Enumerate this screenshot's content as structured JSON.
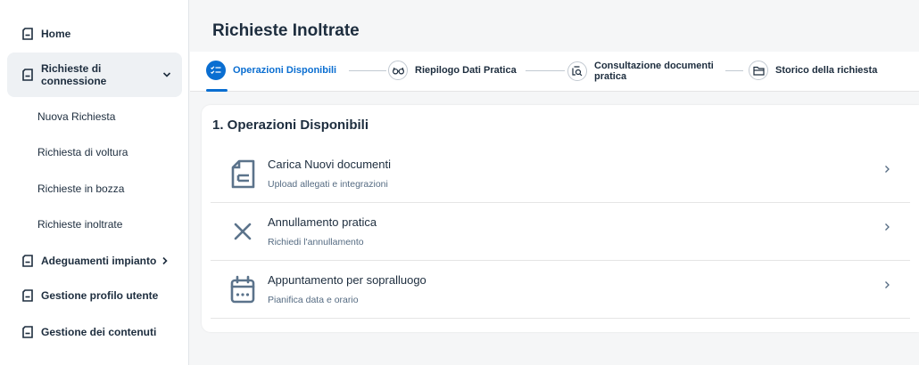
{
  "sidebar": {
    "items": [
      {
        "label": "Home",
        "icon": "document-icon"
      },
      {
        "label": "Richieste di connessione",
        "icon": "document-icon",
        "expanded": true
      },
      {
        "label": "Adeguamenti impianto",
        "icon": "document-icon"
      },
      {
        "label": "Gestione profilo utente",
        "icon": "document-icon"
      },
      {
        "label": "Gestione dei contenuti",
        "icon": "document-icon"
      }
    ],
    "subitems": [
      "Nuova Richiesta",
      "Richiesta di voltura",
      "Richieste in bozza",
      "Richieste inoltrate"
    ]
  },
  "header": {
    "title": "Richieste Inoltrate"
  },
  "steps": [
    {
      "label": "Operazioni Disponibili",
      "icon": "checklist-icon",
      "active": true
    },
    {
      "label": "Riepilogo Dati Pratica",
      "icon": "glasses-icon",
      "active": false
    },
    {
      "label": "Consultazione documenti pratica",
      "icon": "document-search-icon",
      "active": false
    },
    {
      "label": "Storico della richiesta",
      "icon": "folder-icon",
      "active": false
    }
  ],
  "main": {
    "section_title": "1. Operazioni Disponibili",
    "operations": [
      {
        "title": "Carica Nuovi documenti",
        "subtitle": "Upload allegati e integrazioni",
        "icon": "upload-document-icon"
      },
      {
        "title": "Annullamento pratica",
        "subtitle": "Richiedi l'annullamento",
        "icon": "close-icon"
      },
      {
        "title": "Appuntamento per sopralluogo",
        "subtitle": "Pianifica data e orario",
        "icon": "calendar-icon"
      }
    ]
  },
  "colors": {
    "accent": "#0a6ed1",
    "text": "#1d2d3e",
    "muted": "#556b82",
    "background": "#f5f6f7"
  }
}
